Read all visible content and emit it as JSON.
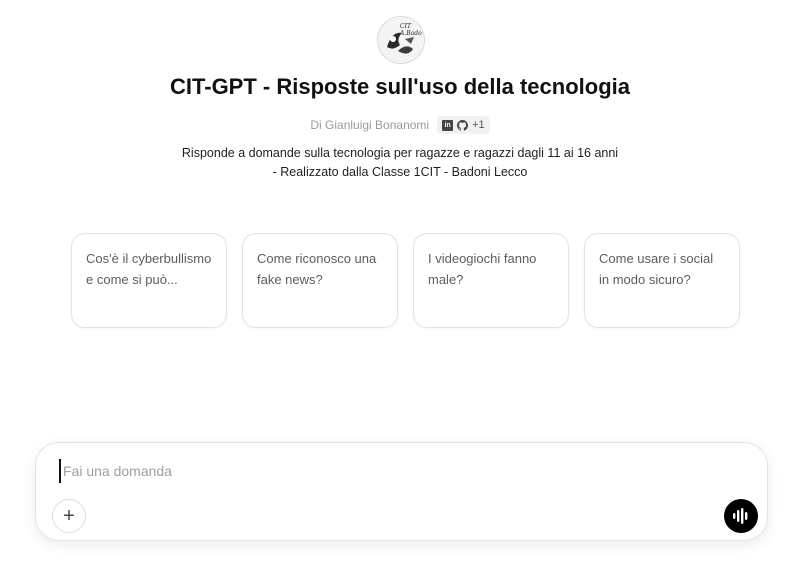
{
  "gpt": {
    "logo_text": "CIT\nA.Bado",
    "title": "CIT-GPT - Risposte sull'uso della tecnologia",
    "author": "Di Gianluigi Bonanomi",
    "social": {
      "linkedin_label": "in",
      "extra_count": "+1"
    },
    "description": "Risponde a domande sulla tecnologia per ragazze e ragazzi dagli 11 ai 16 anni - Realizzato dalla Classe 1CIT - Badoni Lecco"
  },
  "suggestions": [
    {
      "text": "Cos'è il cyberbullismo e come si può..."
    },
    {
      "text": "Come riconosco una fake news?"
    },
    {
      "text": "I videogiochi fanno male?"
    },
    {
      "text": "Come usare i social in modo sicuro?"
    }
  ],
  "composer": {
    "placeholder": "Fai una domanda",
    "plus_label": "+"
  },
  "icons": {
    "add": "plus-icon",
    "voice": "voice-waveform-icon",
    "linkedin": "linkedin-icon",
    "github": "github-icon"
  }
}
